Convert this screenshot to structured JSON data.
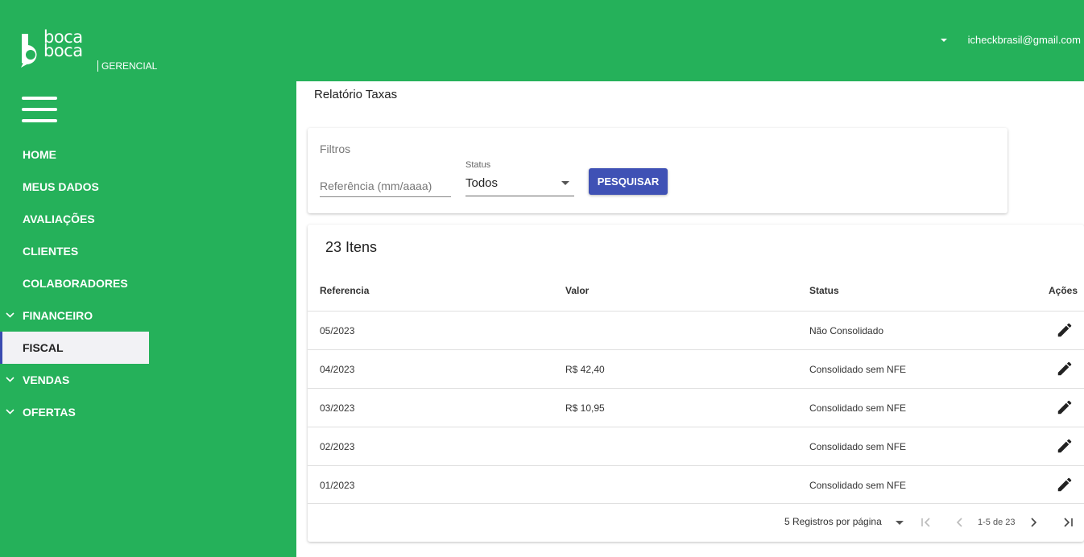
{
  "header": {
    "logo_text_line1": "boca",
    "logo_text_line2": "boca",
    "logo_sub": "GERENCIAL",
    "user_email": "icheckbrasil@gmail.com"
  },
  "sidebar": {
    "items": [
      {
        "label": "HOME"
      },
      {
        "label": "MEUS DADOS"
      },
      {
        "label": "AVALIAÇÕES"
      },
      {
        "label": "CLIENTES"
      },
      {
        "label": "COLABORADORES"
      },
      {
        "label": "FINANCEIRO"
      },
      {
        "label": "FISCAL"
      },
      {
        "label": "VENDAS"
      },
      {
        "label": "OFERTAS"
      }
    ]
  },
  "page": {
    "title": "Relatório Taxas"
  },
  "filters": {
    "label": "Filtros",
    "reference_placeholder": "Referência (mm/aaaa)",
    "status_caption": "Status",
    "status_value": "Todos",
    "search_label": "PESQUISAR"
  },
  "table": {
    "count_label": "23 Itens",
    "headers": [
      "Referencia",
      "Valor",
      "Status",
      "Ações"
    ],
    "rows": [
      {
        "ref": "05/2023",
        "valor": "",
        "status": "Não Consolidado"
      },
      {
        "ref": "04/2023",
        "valor": "R$ 42,40",
        "status": "Consolidado sem NFE"
      },
      {
        "ref": "03/2023",
        "valor": "R$ 10,95",
        "status": "Consolidado sem NFE"
      },
      {
        "ref": "02/2023",
        "valor": "",
        "status": "Consolidado sem NFE"
      },
      {
        "ref": "01/2023",
        "valor": "",
        "status": "Consolidado sem NFE"
      }
    ],
    "rows_per_page_label": "5 Registros por página",
    "page_range": "1-5 de 23"
  },
  "colors": {
    "brand_green": "#25b15a",
    "primary_blue": "#3f51b5"
  }
}
